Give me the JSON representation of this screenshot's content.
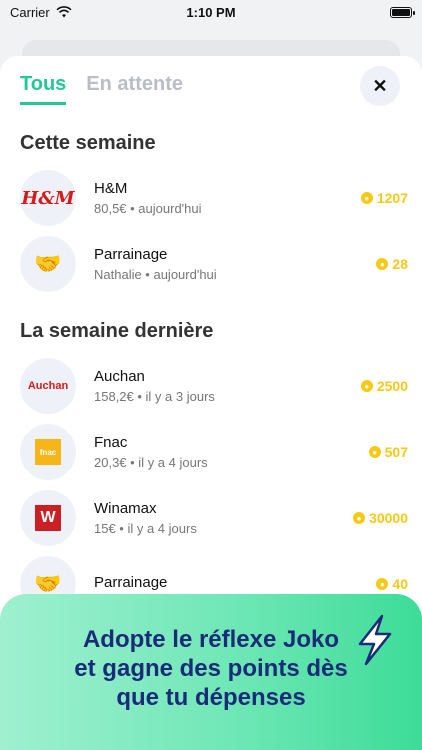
{
  "status": {
    "carrier": "Carrier",
    "time": "1:10 PM"
  },
  "tabs": [
    {
      "label": "Tous"
    },
    {
      "label": "En attente"
    }
  ],
  "close_label": "✕",
  "sections": [
    {
      "title": "Cette semaine"
    },
    {
      "title": "La semaine dernière"
    }
  ],
  "transactions": [
    {
      "name": "H&M",
      "detail": "80,5€ • aujourd'hui",
      "points": "1207",
      "logo_text": "H&M",
      "logo": "hm-logo-icon"
    },
    {
      "name": "Parrainage",
      "detail": "Nathalie • aujourd'hui",
      "points": "28",
      "logo_text": "🤝",
      "logo": "handshake-icon"
    },
    {
      "name": "Auchan",
      "detail": "158,2€ • il y a 3 jours",
      "points": "2500",
      "logo_text": "Auchan",
      "logo": "auchan-logo-icon"
    },
    {
      "name": "Fnac",
      "detail": "20,3€ • il y a 4 jours",
      "points": "507",
      "logo_text": "fnac",
      "logo": "fnac-logo-icon"
    },
    {
      "name": "Winamax",
      "detail": "15€ • il y a 4 jours",
      "points": "30000",
      "logo_text": "W",
      "logo": "winamax-logo-icon"
    },
    {
      "name": "Parrainage",
      "detail": "",
      "points": "40",
      "logo_text": "🤝",
      "logo": "handshake-icon"
    }
  ],
  "banner": {
    "line1": "Adopte le réflexe Joko",
    "line2": "et gagne des points dès",
    "line3": "que tu dépenses"
  },
  "colors": {
    "accent": "#20c997",
    "points": "#f6c915",
    "banner_text": "#1a2b7a"
  }
}
